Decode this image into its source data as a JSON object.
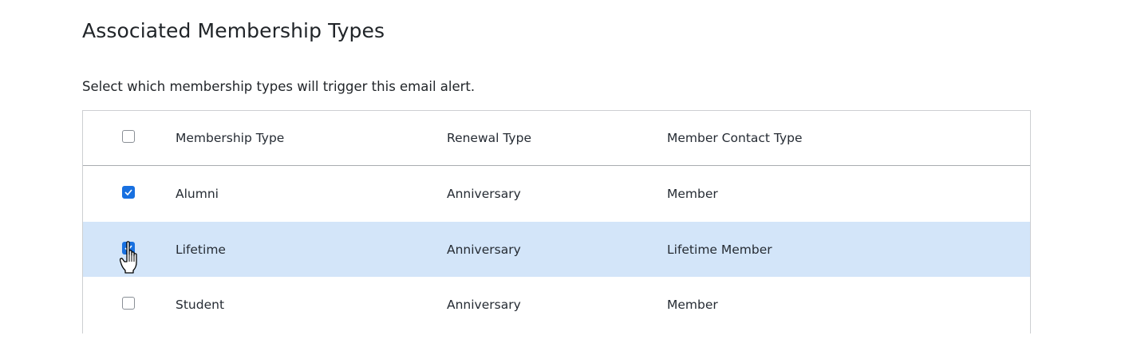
{
  "section": {
    "title": "Associated Membership Types",
    "description": "Select which membership types will trigger this email alert."
  },
  "table": {
    "columns": [
      "Membership Type",
      "Renewal Type",
      "Member Contact Type"
    ],
    "select_all_checked": false,
    "rows": [
      {
        "membership_type": "Alumni",
        "renewal_type": "Anniversary",
        "member_contact_type": "Member",
        "checked": true
      },
      {
        "membership_type": "Lifetime",
        "renewal_type": "Anniversary",
        "member_contact_type": "Lifetime Member",
        "checked": true,
        "highlighted": true
      },
      {
        "membership_type": "Student",
        "renewal_type": "Anniversary",
        "member_contact_type": "Member",
        "checked": false
      }
    ]
  },
  "colors": {
    "accent": "#1870e0",
    "selected_row": "#d3e5f9"
  },
  "icons": {
    "cursor": "hand-pointer-icon",
    "check": "checkmark-icon"
  }
}
